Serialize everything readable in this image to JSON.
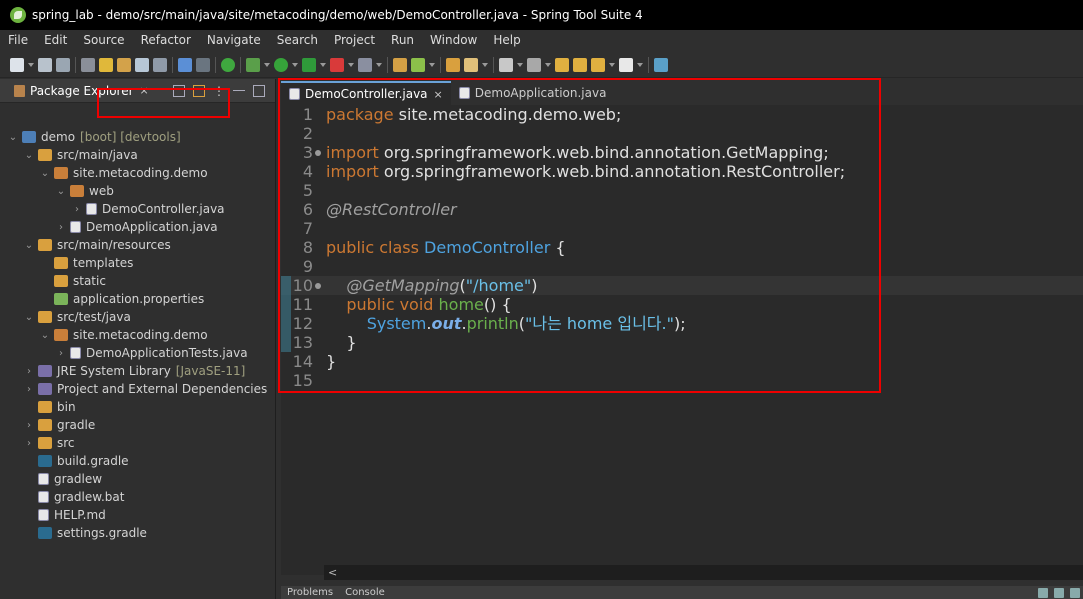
{
  "window": {
    "title": "spring_lab - demo/src/main/java/site/metacoding/demo/web/DemoController.java - Spring Tool Suite 4"
  },
  "menu": [
    "File",
    "Edit",
    "Source",
    "Refactor",
    "Navigate",
    "Search",
    "Project",
    "Run",
    "Window",
    "Help"
  ],
  "explorer": {
    "tab_label": "Package Explorer",
    "close_glyph": "×",
    "items": [
      {
        "label": "demo",
        "extra": "[boot] [devtools]",
        "icon": "project-icon",
        "expanded": true
      },
      {
        "label": "src/main/java",
        "icon": "source-folder-icon",
        "expanded": true
      },
      {
        "label": "site.metacoding.demo",
        "icon": "package-icon",
        "expanded": true
      },
      {
        "label": "web",
        "icon": "package-icon",
        "expanded": true
      },
      {
        "label": "DemoController.java",
        "icon": "java-file-icon",
        "expanded": false
      },
      {
        "label": "DemoApplication.java",
        "icon": "java-file-icon",
        "expanded": false
      },
      {
        "label": "src/main/resources",
        "icon": "source-folder-icon",
        "expanded": true
      },
      {
        "label": "templates",
        "icon": "folder-icon"
      },
      {
        "label": "static",
        "icon": "folder-icon"
      },
      {
        "label": "application.properties",
        "icon": "properties-icon"
      },
      {
        "label": "src/test/java",
        "icon": "source-folder-icon",
        "expanded": true
      },
      {
        "label": "site.metacoding.demo",
        "icon": "package-icon",
        "expanded": true
      },
      {
        "label": "DemoApplicationTests.java",
        "icon": "java-file-icon",
        "expanded": false
      },
      {
        "label": "JRE System Library",
        "extra": "[JavaSE-11]",
        "icon": "library-icon",
        "expanded": false
      },
      {
        "label": "Project and External Dependencies",
        "icon": "library-icon",
        "expanded": false
      },
      {
        "label": "bin",
        "icon": "folder-icon"
      },
      {
        "label": "gradle",
        "icon": "folder-icon",
        "expanded": false
      },
      {
        "label": "src",
        "icon": "folder-icon",
        "expanded": false
      },
      {
        "label": "build.gradle",
        "icon": "gradle-icon"
      },
      {
        "label": "gradlew",
        "icon": "file-icon"
      },
      {
        "label": "gradlew.bat",
        "icon": "file-icon"
      },
      {
        "label": "HELP.md",
        "icon": "markdown-icon"
      },
      {
        "label": "settings.gradle",
        "icon": "gradle-icon"
      }
    ]
  },
  "editor": {
    "tabs": [
      {
        "label": "DemoController.java",
        "active": true,
        "close": "×"
      },
      {
        "label": "DemoApplication.java",
        "active": false
      }
    ],
    "current_line": 10,
    "lines": [
      {
        "n": "1",
        "tokens": [
          [
            "kw",
            "package"
          ],
          [
            "plain",
            " site.metacoding.demo.web;"
          ]
        ]
      },
      {
        "n": "2",
        "tokens": []
      },
      {
        "n": "3",
        "fold": true,
        "tokens": [
          [
            "kw",
            "import"
          ],
          [
            "plain",
            " org.springframework.web.bind.annotation.GetMapping;"
          ]
        ]
      },
      {
        "n": "4",
        "tokens": [
          [
            "kw",
            "import"
          ],
          [
            "plain",
            " org.springframework.web.bind.annotation.RestController;"
          ]
        ]
      },
      {
        "n": "5",
        "tokens": []
      },
      {
        "n": "6",
        "tokens": [
          [
            "ann",
            "@RestController"
          ]
        ]
      },
      {
        "n": "7",
        "tokens": []
      },
      {
        "n": "8",
        "tokens": [
          [
            "kw",
            "public class "
          ],
          [
            "cls",
            "DemoController"
          ],
          [
            "plain",
            " {"
          ]
        ]
      },
      {
        "n": "9",
        "tokens": []
      },
      {
        "n": "10",
        "fold": true,
        "tokens": [
          [
            "plain",
            "    "
          ],
          [
            "ann",
            "@GetMapping"
          ],
          [
            "plain",
            "("
          ],
          [
            "str",
            "\"/home\""
          ],
          [
            "plain",
            ")"
          ]
        ]
      },
      {
        "n": "11",
        "tokens": [
          [
            "plain",
            "    "
          ],
          [
            "kw",
            "public void "
          ],
          [
            "mth",
            "home"
          ],
          [
            "plain",
            "() {"
          ]
        ]
      },
      {
        "n": "12",
        "tokens": [
          [
            "plain",
            "        "
          ],
          [
            "cls",
            "System"
          ],
          [
            "plain",
            "."
          ],
          [
            "fld",
            "out"
          ],
          [
            "plain",
            "."
          ],
          [
            "mth",
            "println"
          ],
          [
            "plain",
            "("
          ],
          [
            "str",
            "\"나는 home 입니다.\""
          ],
          [
            "plain",
            ");"
          ]
        ]
      },
      {
        "n": "13",
        "tokens": [
          [
            "plain",
            "    }"
          ]
        ]
      },
      {
        "n": "14",
        "tokens": [
          [
            "plain",
            "}"
          ]
        ]
      },
      {
        "n": "15",
        "tokens": []
      }
    ],
    "scroll_left_glyph": "<"
  },
  "bottom_panel": {
    "tabs": [
      "Problems",
      "Console"
    ]
  },
  "colors": {
    "highlight_border": "#e00000",
    "keyword": "#cc7832",
    "class": "#4ea3e0",
    "string": "#6ac0e8"
  }
}
